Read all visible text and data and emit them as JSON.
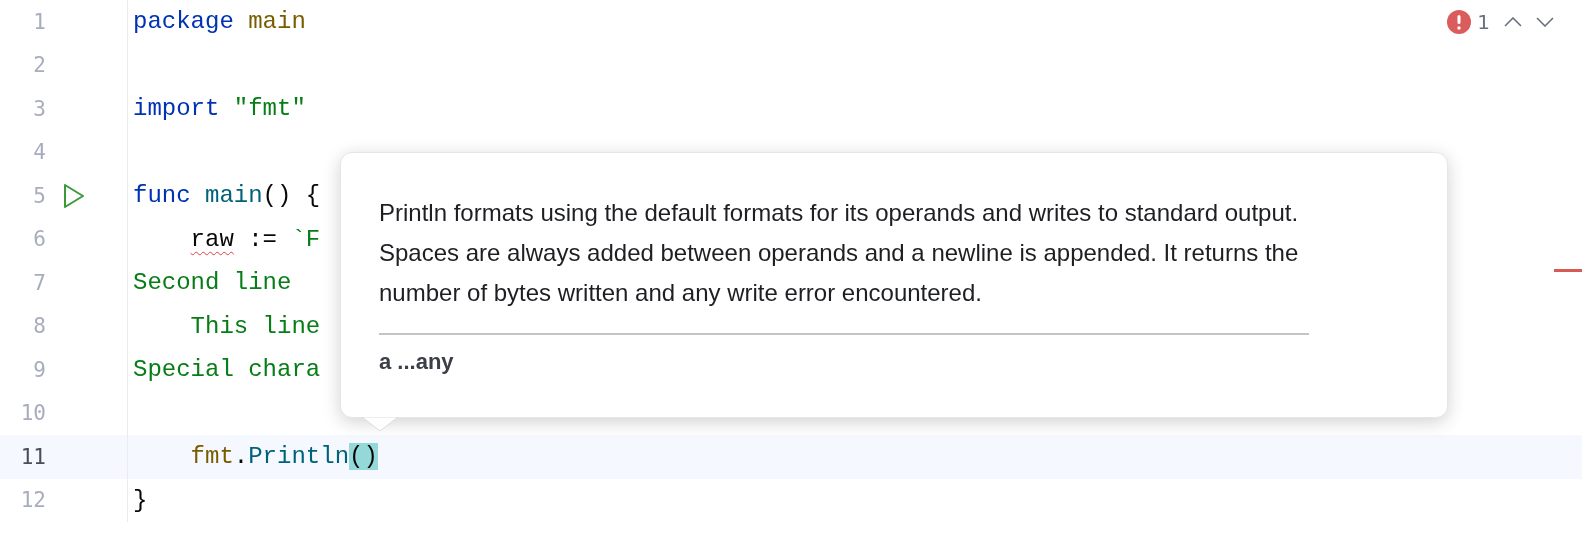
{
  "editor": {
    "lines": [
      {
        "number": "1",
        "current": false,
        "run_marker": false,
        "indented": false,
        "tokens": [
          {
            "text": "package",
            "kind": "keyword"
          },
          {
            "text": "main",
            "kind": "package",
            "space_before": true
          }
        ]
      },
      {
        "number": "2",
        "current": false,
        "run_marker": false
      },
      {
        "number": "3",
        "current": false,
        "run_marker": false,
        "indented": false,
        "tokens": [
          {
            "text": "import",
            "kind": "keyword"
          },
          {
            "text": "\"fmt\"",
            "kind": "string",
            "space_before": true
          }
        ]
      },
      {
        "number": "4",
        "current": false,
        "run_marker": false
      },
      {
        "number": "5",
        "current": false,
        "run_marker": true,
        "indented": false,
        "tokens": [
          {
            "text": "func",
            "kind": "keyword"
          },
          {
            "text": "main",
            "kind": "function",
            "space_before": true
          },
          {
            "text": "()",
            "kind": "plain"
          },
          {
            "text": "{",
            "kind": "plain",
            "space_before": true
          }
        ]
      },
      {
        "number": "6",
        "current": false,
        "run_marker": false,
        "indented": true,
        "tokens": [
          {
            "text": "raw",
            "kind": "plain",
            "error": true
          },
          {
            "text": ":=",
            "kind": "plain",
            "space_before": true
          },
          {
            "text": "`F",
            "kind": "string",
            "space_before": true
          }
        ]
      },
      {
        "number": "7",
        "current": false,
        "run_marker": false,
        "indented": false,
        "tokens": [
          {
            "text": "Second line",
            "kind": "string"
          }
        ]
      },
      {
        "number": "8",
        "current": false,
        "run_marker": false,
        "indented": true,
        "tokens": [
          {
            "text": "This line",
            "kind": "string"
          }
        ]
      },
      {
        "number": "9",
        "current": false,
        "run_marker": false,
        "indented": false,
        "tokens": [
          {
            "text": "Special chara",
            "kind": "string"
          }
        ]
      },
      {
        "number": "10",
        "current": false,
        "run_marker": false
      },
      {
        "number": "11",
        "current": true,
        "run_marker": false,
        "indented": true,
        "tokens": [
          {
            "text": "fmt",
            "kind": "package"
          },
          {
            "text": ".",
            "kind": "plain"
          },
          {
            "text": "Println",
            "kind": "function"
          },
          {
            "text": "()",
            "kind": "plain",
            "matched": true
          }
        ]
      },
      {
        "number": "12",
        "current": false,
        "run_marker": false,
        "indented": false,
        "tokens": [
          {
            "text": "}",
            "kind": "plain"
          }
        ]
      }
    ]
  },
  "inspection": {
    "count": "1"
  },
  "popup": {
    "text": "Println formats using the default formats for its operands and writes to standard output. Spaces are always added between operands and a newline is appended. It returns the number of bytes written and any write error encountered.",
    "signature": "a ...any"
  }
}
